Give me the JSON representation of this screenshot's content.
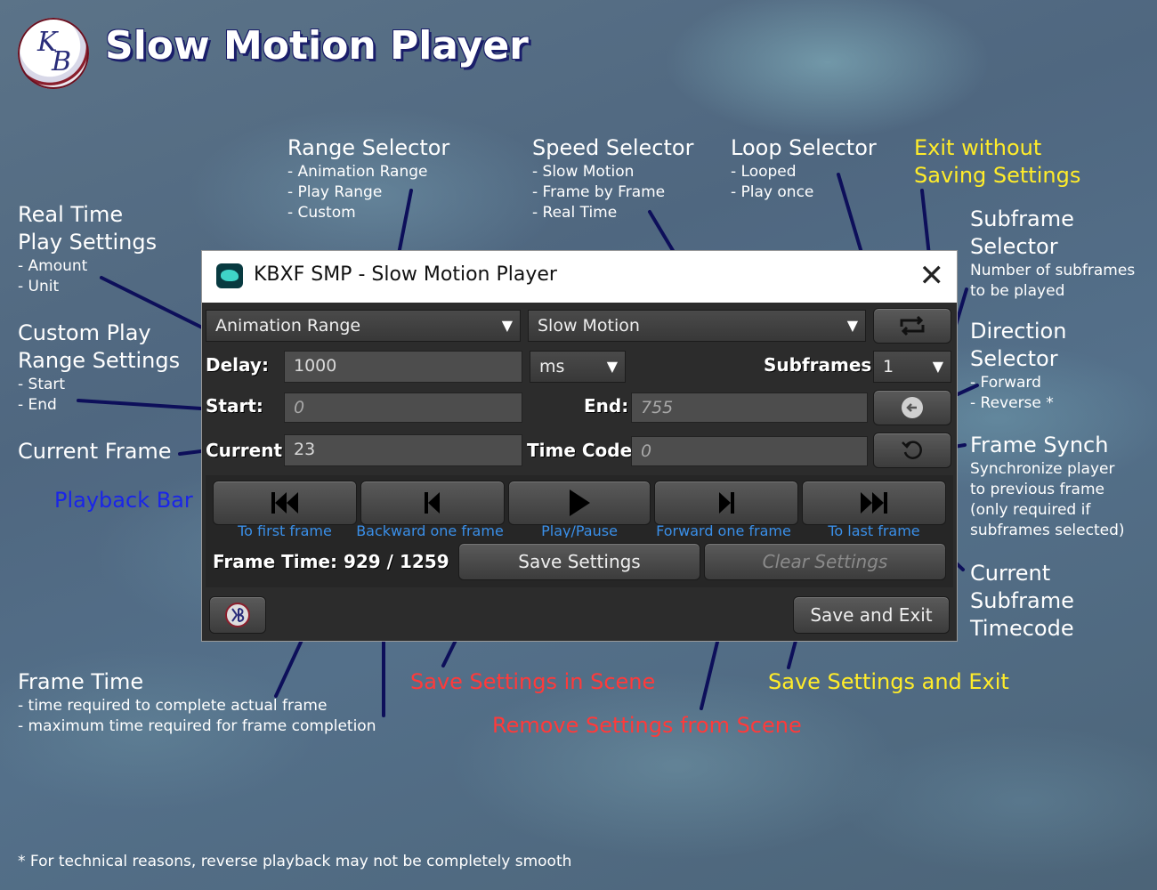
{
  "header": {
    "title": "Slow Motion Player",
    "logo_text_1": "K",
    "logo_text_2": "B"
  },
  "dialog": {
    "window_title": "KBXF SMP - Slow Motion Player",
    "close_label": "✕",
    "range_selector": "Animation Range",
    "speed_selector": "Slow Motion",
    "delay_label": "Delay:",
    "delay_value": "1000",
    "unit_value": "ms",
    "subframes_label": "Subframes:",
    "subframes_value": "1",
    "start_label": "Start:",
    "start_value": "0",
    "end_label": "End:",
    "end_value": "755",
    "current_label": "Current:",
    "current_value": "23",
    "timecode_label": "Time Code:",
    "timecode_value": "0",
    "frame_time": "Frame Time: 929 / 1259",
    "save_settings": "Save Settings",
    "clear_settings": "Clear Settings",
    "save_and_exit": "Save and Exit",
    "playback": [
      {
        "icon": "first-frame-icon",
        "caption": "To first frame"
      },
      {
        "icon": "backward-frame-icon",
        "caption": "Backward one frame"
      },
      {
        "icon": "play-pause-icon",
        "caption": "Play/Pause"
      },
      {
        "icon": "forward-frame-icon",
        "caption": "Forward one frame"
      },
      {
        "icon": "last-frame-icon",
        "caption": "To last frame"
      }
    ],
    "loop_icon": "loop-icon",
    "direction_icon": "arrow-left-icon",
    "sync_icon": "refresh-icon"
  },
  "annotations": {
    "range_selector": {
      "title": "Range Selector",
      "items": [
        "- Animation Range",
        "- Play Range",
        "- Custom"
      ]
    },
    "speed_selector": {
      "title": "Speed Selector",
      "items": [
        "- Slow Motion",
        "- Frame by Frame",
        "- Real Time"
      ]
    },
    "loop_selector": {
      "title": "Loop Selector",
      "items": [
        "- Looped",
        "- Play once"
      ]
    },
    "exit_without_saving": {
      "line1": "Exit without",
      "line2": "Saving Settings"
    },
    "subframe_selector": {
      "line1": "Subframe",
      "line2": "Selector",
      "desc1": "Number of subframes",
      "desc2": "to be played"
    },
    "direction_selector": {
      "line1": "Direction",
      "line2": "Selector",
      "items": [
        "- Forward",
        "- Reverse *"
      ]
    },
    "frame_synch": {
      "title": "Frame Synch",
      "desc": [
        "Synchronize player",
        "to previous frame",
        "(only required if",
        "subframes selected)"
      ]
    },
    "current_subframe_timecode": {
      "lines": [
        "Current",
        "Subframe",
        "Timecode"
      ]
    },
    "real_time_play": {
      "line1": "Real Time",
      "line2": "Play Settings",
      "items": [
        "- Amount",
        "- Unit"
      ]
    },
    "custom_play_range": {
      "line1": "Custom Play",
      "line2": "Range Settings",
      "items": [
        "- Start",
        "- End"
      ]
    },
    "current_frame": "Current Frame",
    "playback_bar": "Playback Bar",
    "frame_time": {
      "title": "Frame Time",
      "items": [
        "- time required to complete actual frame",
        "- maximum time required for frame completion"
      ]
    },
    "save_in_scene": "Save Settings in Scene",
    "remove_from_scene": "Remove Settings from Scene",
    "save_and_exit": "Save Settings and Exit"
  },
  "footnote": "* For technical reasons, reverse playback may not be completely smooth",
  "colors": {
    "annotation_yellow": "#ffec2a",
    "annotation_red": "#ff3a3a",
    "annotation_blue": "#1a25e8",
    "caption_blue": "#3a8fe8",
    "line_navy": "#0d0f5a"
  }
}
